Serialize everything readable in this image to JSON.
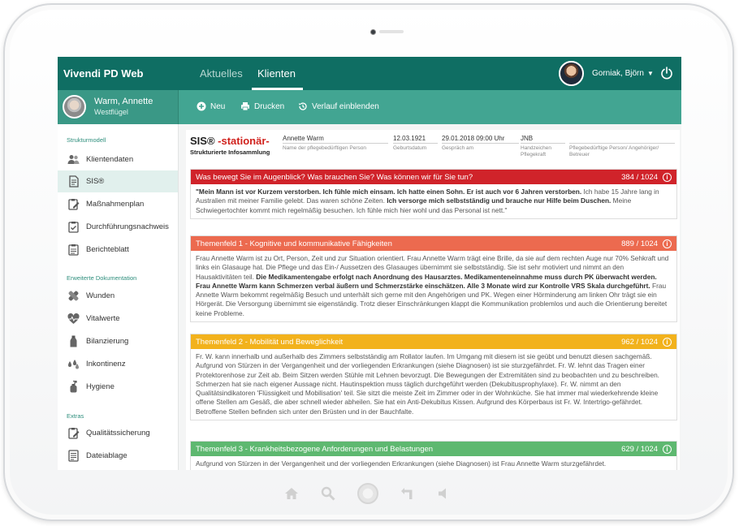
{
  "app": {
    "title": "Vivendi PD Web",
    "tabs": [
      {
        "label": "Aktuelles",
        "active": false
      },
      {
        "label": "Klienten",
        "active": true
      }
    ],
    "user": {
      "name": "Gorniak, Björn"
    }
  },
  "patient": {
    "name": "Warm, Annette",
    "unit": "Westflügel"
  },
  "toolbar": {
    "new_label": "Neu",
    "print_label": "Drucken",
    "history_label": "Verlauf einblenden"
  },
  "sidebar": {
    "sections": [
      {
        "title": "Strukturmodell",
        "items": [
          {
            "label": "Klientendaten",
            "icon": "people-icon",
            "active": false
          },
          {
            "label": "SIS®",
            "icon": "document-icon",
            "active": true
          },
          {
            "label": "Maßnahmenplan",
            "icon": "clipboard-edit-icon",
            "active": false
          },
          {
            "label": "Durchführungsnachweis",
            "icon": "clipboard-check-icon",
            "active": false
          },
          {
            "label": "Berichteblatt",
            "icon": "clipboard-icon",
            "active": false
          }
        ]
      },
      {
        "title": "Erweiterte Dokumentation",
        "items": [
          {
            "label": "Wunden",
            "icon": "bandage-icon",
            "active": false
          },
          {
            "label": "Vitalwerte",
            "icon": "heart-pulse-icon",
            "active": false
          },
          {
            "label": "Bilanzierung",
            "icon": "bottle-icon",
            "active": false
          },
          {
            "label": "Inkontinenz",
            "icon": "drops-icon",
            "active": false
          },
          {
            "label": "Hygiene",
            "icon": "soap-icon",
            "active": false
          }
        ]
      },
      {
        "title": "Extras",
        "items": [
          {
            "label": "Qualitätssicherung",
            "icon": "clipboard-pen-icon",
            "active": false
          },
          {
            "label": "Dateiablage",
            "icon": "file-list-icon",
            "active": false
          }
        ]
      }
    ]
  },
  "sis": {
    "title_prefix": "SIS® ",
    "title_highlight": "-stationär-",
    "subtitle": "Strukturierte Infosammlung",
    "fields": [
      {
        "value": "Annette Warm",
        "label": "Name der pflegebedürftigen Person"
      },
      {
        "value": "12.03.1921",
        "label": "Geburtsdatum"
      },
      {
        "value": "29.01.2018 09:00 Uhr",
        "label": "Gespräch am"
      },
      {
        "value": "JNB",
        "label": "Handzeichen Pflegekraft"
      },
      {
        "value": "",
        "label": "Pflegebedürftige Person/ Angehöriger/ Betreuer"
      }
    ],
    "panels": [
      {
        "title": "Was bewegt Sie im Augenblick? Was brauchen Sie? Was können wir für Sie tun?",
        "count": "384 / 1024",
        "color": "#d0232a",
        "segments": [
          {
            "t": "\"Mein Mann ist vor Kurzem verstorben. Ich fühle mich einsam. Ich hatte einen Sohn. Er ist auch vor 6 Jahren verstorben.",
            "b": true
          },
          {
            "t": " Ich habe 15 Jahre lang in Australien mit meiner Familie gelebt. Das waren schöne Zeiten. ",
            "b": false
          },
          {
            "t": "Ich versorge mich selbstständig und brauche nur Hilfe beim Duschen.",
            "b": true
          },
          {
            "t": " Meine Schwiegertochter kommt mich regelmäßig besuchen. Ich fühle mich hier wohl und das Personal ist nett.\"",
            "b": false
          }
        ]
      },
      {
        "title": "Themenfeld 1 - Kognitive und kommunikative Fähigkeiten",
        "count": "889 / 1024",
        "color": "#ec6a4f",
        "segments": [
          {
            "t": "Frau Annette Warm ist zu Ort, Person, Zeit und zur Situation orientiert. Frau Annette Warm trägt eine Brille, da sie auf dem rechten Auge nur 70% Sehkraft und links ein Glasauge hat. Die Pflege und das Ein-/ Aussetzen des Glasauges übernimmt sie selbstständig. Sie ist sehr motiviert und nimmt an den Hausaktivitäten teil. ",
            "b": false
          },
          {
            "t": "Die Medikamentengabe erfolgt nach Anordnung des Hausarztes. Medikamenteneinnahme muss durch PK überwacht werden. Frau Annette Warm kann Schmerzen verbal äußern und Schmerzstärke einschätzen. Alle 3 Monate wird zur Kontrolle VRS Skala durchgeführt.",
            "b": true
          },
          {
            "t": " Frau Annette Warm bekommt regelmäßig Besuch und unterhält sich gerne mit den Angehörigen und PK. Wegen einer Hörminderung am linken Ohr trägt sie ein Hörgerät. Die Versorgung übernimmt sie eigenständig. Trotz dieser Einschränkungen klappt die Kommunikation problemlos und auch die Orientierung bereitet keine Probleme.",
            "b": false
          }
        ]
      },
      {
        "title": "Themenfeld 2 - Mobilität und Beweglichkeit",
        "count": "962 / 1024",
        "color": "#f2b21c",
        "segments": [
          {
            "t": "Fr. W. kann innerhalb und außerhalb des Zimmers selbstständig am Rollator laufen. Im Umgang mit diesem ist sie geübt und benutzt diesen sachgemäß. Aufgrund von Stürzen in der Vergangenheit und der vorliegenden Erkrankungen (siehe Diagnosen) ist sie sturzgefährdet. Fr. W. lehnt das Tragen einer Protektorenhose zur Zeit ab. Beim Sitzen werden Stühle mit Lehnen bevorzugt. Die Bewegungen der Extremitäten sind zu beobachten und zu beschreiben. Schmerzen hat sie  nach eigener Aussage nicht. Hautinspektion muss täglich durchgeführt werden (Dekubitusprophylaxe). Fr. W. nimmt an den Qualitätsindikatoren 'Flüssigkeit und Mobilisation' teil. Sie sitzt die meiste Zeit im Zimmer oder in der Wohnküche. Sie hat immer mal wiederkehrende kleine offene Stellen am Gesäß, die aber schnell wieder abheilen. Sie hat ein Anti-Dekubitus Kissen. Aufgrund des Körperbaus ist Fr. W. Intertrigo-gefährdet. Betroffene Stellen befinden sich unter den Brüsten und in der Bauchfalte.",
            "b": false
          }
        ]
      },
      {
        "title": "Themenfeld 3 - Krankheitsbezogene Anforderungen und Belastungen",
        "count": "629 / 1024",
        "color": "#5eb870",
        "segments": [
          {
            "t": "Aufgrund von Stürzen in der Vergangenheit und der vorliegenden Erkrankungen (siehe Diagnosen) ist Frau Annette Warm sturzgefährdet.",
            "b": false
          }
        ]
      }
    ]
  }
}
